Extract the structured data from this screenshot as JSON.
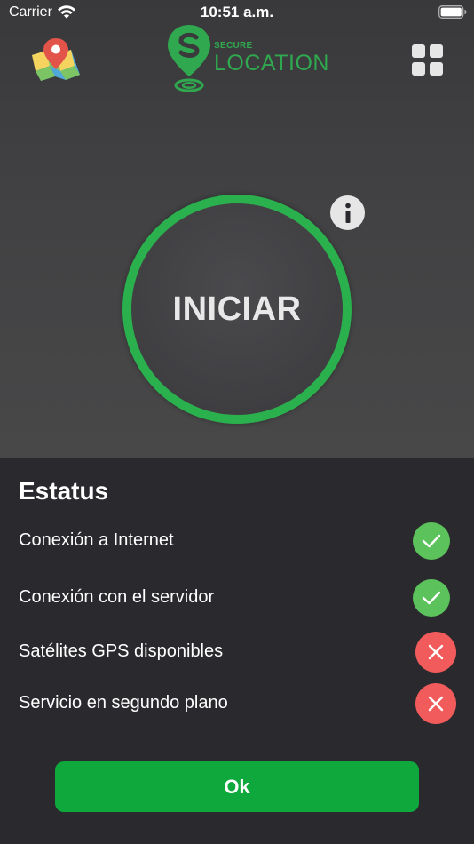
{
  "status_bar": {
    "carrier": "Carrier",
    "time": "10:51 a.m.",
    "wifi_icon": "wifi-icon",
    "battery_icon": "battery-icon"
  },
  "header": {
    "map_icon": "map-pin-icon",
    "logo_small": "SECURE",
    "logo_large": "LOCATION",
    "menu_icon": "grid-icon"
  },
  "main": {
    "start_label": "INICIAR",
    "info_icon": "info-icon",
    "ring_color": "#2bb04e"
  },
  "status_panel": {
    "title": "Estatus",
    "items": [
      {
        "label": "Conexión a Internet",
        "ok": true
      },
      {
        "label": "Conexión con el servidor",
        "ok": true
      },
      {
        "label": "Satélites GPS disponibles",
        "ok": false
      },
      {
        "label": "Servicio en segundo plano",
        "ok": false
      }
    ],
    "ok_color": "#5cc25c",
    "fail_color": "#f25b5b"
  },
  "footer": {
    "ok_label": "Ok",
    "button_color": "#0ea83c"
  }
}
